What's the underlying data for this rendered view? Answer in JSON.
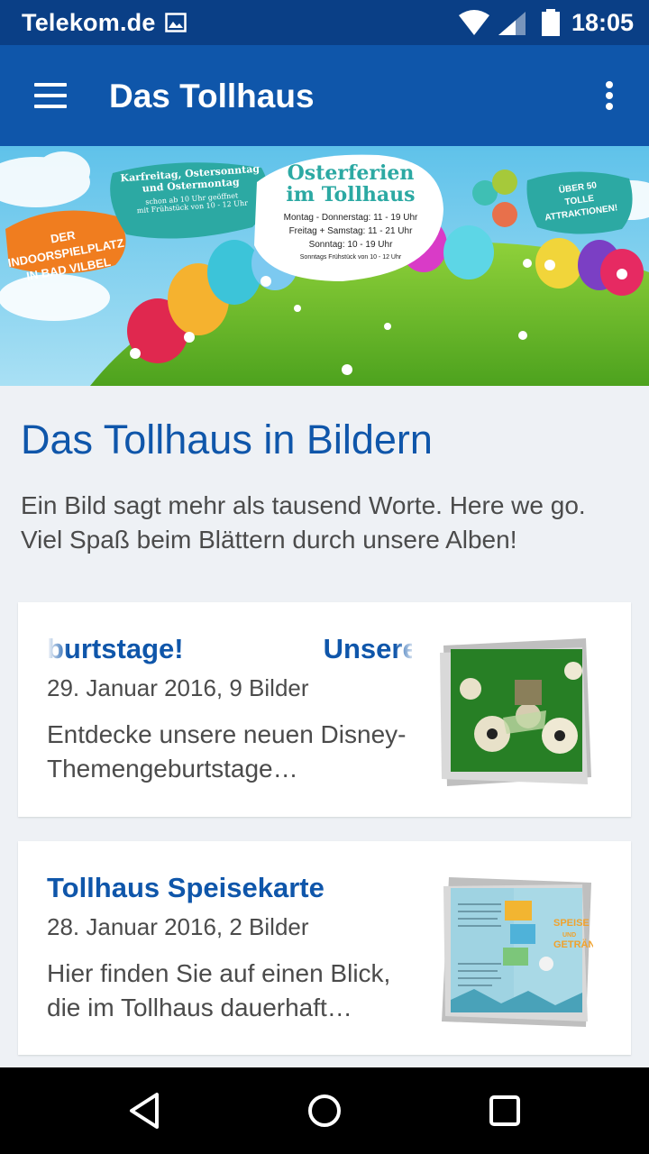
{
  "status_bar": {
    "carrier": "Telekom.de",
    "time": "18:05",
    "icons": [
      "image-icon",
      "wifi-icon",
      "signal-icon",
      "battery-icon"
    ]
  },
  "toolbar": {
    "title": "Das Tollhaus",
    "menu_icon": "hamburger-menu-icon",
    "more_icon": "more-vert-icon"
  },
  "banner": {
    "bubble_left": "DER INDOORSPIELPLATZ IN BAD VILBEL",
    "bubble_days_line1": "Karfreitag, Ostersonntag",
    "bubble_days_line2": "und Ostermontag",
    "bubble_days_line3": "schon ab 10 Uhr geöffnet",
    "bubble_days_line4": "mit Frühstück von 10 - 12 Uhr",
    "bubble_main_title1": "Osterferien",
    "bubble_main_title2": "im Tollhaus",
    "hours_1": "Montag - Donnerstag: 11 - 19 Uhr",
    "hours_2": "Freitag + Samstag: 11 - 21 Uhr",
    "hours_3": "Sonntag: 10 - 19 Uhr",
    "hours_4": "Sonntags Frühstück von 10 - 12 Uhr",
    "bubble_right_1": "ÜBER 50",
    "bubble_right_2": "TOLLE ATTRAKTIONEN!"
  },
  "section": {
    "title": "Das Tollhaus in Bildern",
    "description": "Ein Bild sagt mehr als tausend Worte. Here we go. Viel Spaß beim Blättern durch unsere Alben!"
  },
  "albums": [
    {
      "title": "burtstage!                  Unsere",
      "meta": "29. Januar 2016, 9 Bilder",
      "text": "Entdecke unsere neuen Disney-Themengeburtstage…",
      "thumb_icon": "soccer-party-thumbnail"
    },
    {
      "title": "Tollhaus Speisekarte",
      "meta": "28. Januar 2016, 2 Bilder",
      "text": "Hier finden Sie auf einen Blick, die im Tollhaus dauerhaft…",
      "thumb_icon": "menu-card-thumbnail",
      "thumb_text_1": "SPEISE",
      "thumb_text_2": "UND",
      "thumb_text_3": "GETRÄN"
    }
  ],
  "nav": {
    "back_icon": "back-icon",
    "home_icon": "home-icon",
    "recents_icon": "recents-icon"
  }
}
